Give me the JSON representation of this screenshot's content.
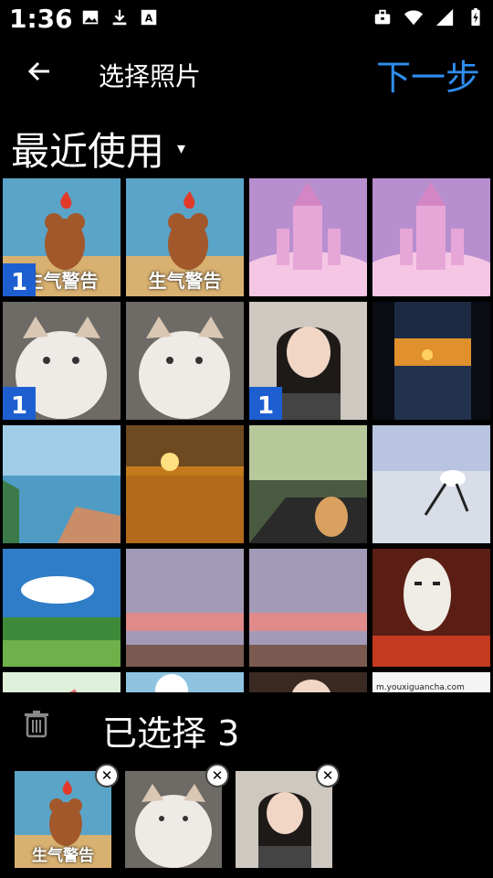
{
  "status": {
    "time": "1:36"
  },
  "toolbar": {
    "title": "选择照片",
    "next_label": "下一步"
  },
  "album": {
    "label": "最近使用",
    "caret": "▾"
  },
  "grid": {
    "captions": {
      "angry": "生气警告"
    },
    "badges": {
      "b1": "1",
      "b2": "1",
      "b3": "1"
    },
    "site_text": "m.youxiguancha.com"
  },
  "selection": {
    "label": "已选择 3",
    "remove_symbol": "✕"
  }
}
